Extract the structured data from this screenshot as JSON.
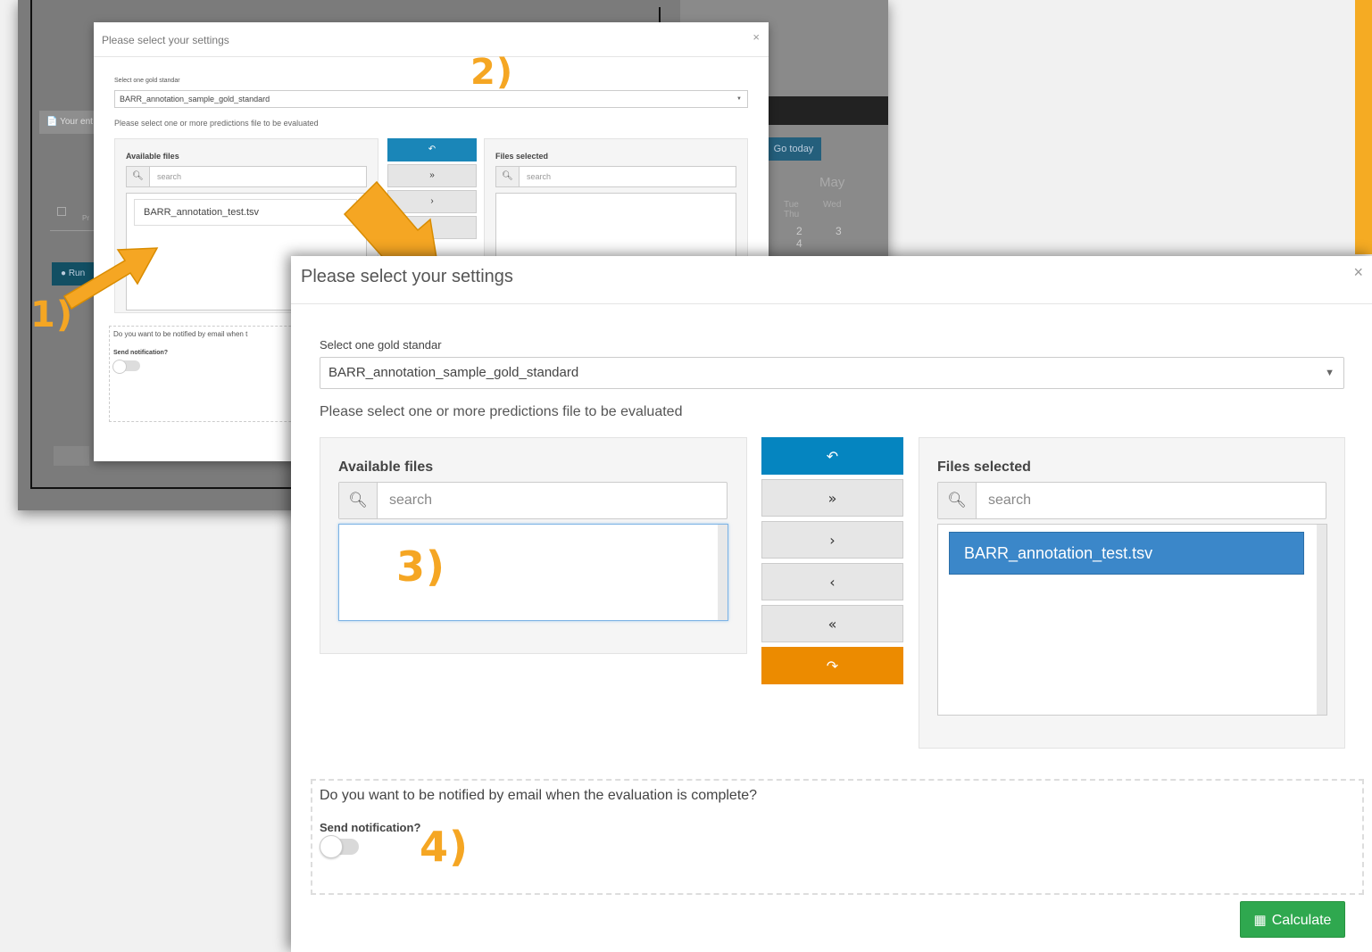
{
  "colors": {
    "annotation": "#f5a623",
    "primary_blue": "#0585c0",
    "selected_item": "#3b87c9",
    "orange_button": "#ec8b00",
    "green_button": "#2fa84f"
  },
  "background": {
    "your_entries_label": "Your ent",
    "run_label": "Run",
    "pr_label": "Pr",
    "go_today": "Go today",
    "month": "May",
    "weekdays": [
      "Tue",
      "Wed",
      "Thu"
    ],
    "day_numbers": [
      "2",
      "3",
      "4"
    ]
  },
  "steps": {
    "step1": "1)",
    "step2": "2)",
    "step3": "3)",
    "step4": "4)"
  },
  "small_modal": {
    "title": "Please select your settings",
    "close": "×",
    "gold_label": "Select one gold standar",
    "gold_value": "BARR_annotation_sample_gold_standard",
    "predictions_label": "Please select one or more predictions file to be evaluated",
    "available_title": "Available files",
    "selected_title": "Files selected",
    "search_placeholder": "search",
    "available_file": "BARR_annotation_test.tsv",
    "notify_question": "Do you want to be notified by email when t",
    "send_notification": "Send notification?"
  },
  "modal": {
    "title": "Please select your settings",
    "close": "×",
    "gold_label": "Select one gold standar",
    "gold_value": "BARR_annotation_sample_gold_standard",
    "predictions_label": "Please select one or more predictions file to be evaluated",
    "available": {
      "title": "Available files",
      "search_placeholder": "search"
    },
    "selected": {
      "title": "Files selected",
      "search_placeholder": "search",
      "items": [
        "BARR_annotation_test.tsv"
      ]
    },
    "transfer_buttons": {
      "undo": "↶",
      "move_all_right": "»",
      "move_right": "›",
      "move_left": "‹",
      "move_all_left": "«",
      "redo": "↷"
    },
    "notify_question": "Do you want to be notified by email when the evaluation is complete?",
    "send_notification": "Send notification?",
    "send_notification_on": false,
    "calculate_label": "Calculate"
  }
}
